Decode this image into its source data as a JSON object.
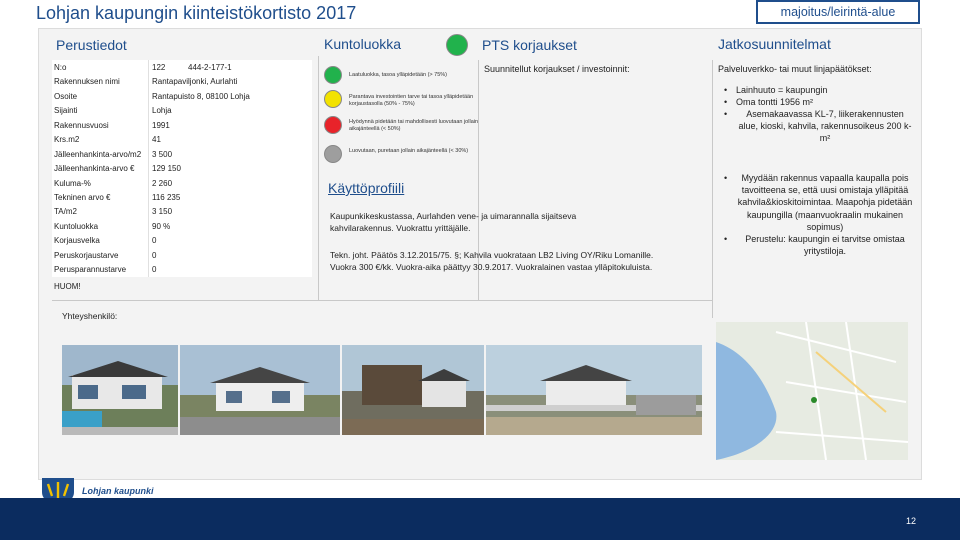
{
  "title": "Lohjan kaupungin kiinteistökortisto 2017",
  "category": "majoitus/leirintä-alue",
  "headers": {
    "basic": "Perustiedot",
    "condition": "Kuntoluokka",
    "pts": "PTS korjaukset",
    "future": "Jatkosuunnitelmat"
  },
  "condition_color": "#21b24c",
  "basic_rows": [
    {
      "k": "N:o",
      "v": "122",
      "v2": "444-2-177-1"
    },
    {
      "k": "Rakennuksen nimi",
      "v": "Rantapaviljonki, Aurlahti",
      "v2": ""
    },
    {
      "k": "Osoite",
      "v": "Rantapuisto 8, 08100 Lohja",
      "v2": ""
    },
    {
      "k": "Sijainti",
      "v": "Lohja",
      "v2": ""
    },
    {
      "k": "Rakennusvuosi",
      "v": "1991",
      "v2": ""
    },
    {
      "k": "Krs.m2",
      "v": "41",
      "v2": ""
    },
    {
      "k": "Jälleenhankinta-arvo/m2",
      "v": "3 500",
      "v2": ""
    },
    {
      "k": "Jälleenhankinta-arvo €",
      "v": "129 150",
      "v2": ""
    },
    {
      "k": "Kuluma-%",
      "v": "2 260",
      "v2": ""
    },
    {
      "k": "Tekninen arvo €",
      "v": "116 235",
      "v2": ""
    },
    {
      "k": "TA/m2",
      "v": "3 150",
      "v2": ""
    },
    {
      "k": "Kuntoluokka",
      "v": "90 %",
      "v2": ""
    },
    {
      "k": "Korjausvelka",
      "v": "0",
      "v2": ""
    },
    {
      "k": "Peruskorjaustarve",
      "v": "0",
      "v2": ""
    },
    {
      "k": "Perusparannustarve",
      "v": "0",
      "v2": ""
    }
  ],
  "huom": "HUOM!",
  "legend": [
    "Laatuluokka, tasoa ylläpidetään (> 75%)",
    "Parantava investointien tarve tai tasoa ylläpidetään korjaustasolla (50% - 75%)",
    "Hyödynnä pidetään tai mahdollisesti luovutaan jollain aikajänteellä (< 50%)",
    "Luovutaan, puretaan jollain aikajänteellä (< 30%)"
  ],
  "profile": {
    "title": "Käyttöprofiili",
    "p1": "Kaupunkikeskustassa, Aurlahden vene- ja uimarannalla sijaitseva kahvilarakennus. Vuokrattu yrittäjälle.",
    "p2": "Tekn. joht. Päätös 3.12.2015/75. §; Kahvila vuokrataan LB2 Living OY/Riku Lomanille. Vuokra 300 €/kk. Vuokra-aika päättyy 30.9.2017. Vuokralainen vastaa ylläpitokuluista."
  },
  "pts_text": "Suunnitellut korjaukset / investoinnit:",
  "future_text": "Palveluverkko- tai muut linjapäätökset:",
  "bullets1": [
    "Lainhuuto = kaupungin",
    "Oma tontti 1956 m²",
    "Asemakaavassa KL-7, liikerakennusten alue, kioski, kahvila, rakennusoikeus 200 k-m²"
  ],
  "bullets2": [
    "Myydään rakennus vapaalla kaupalla pois tavoitteena se, että uusi omistaja ylläpitää kahvila&kioskitoimintaa. Maapohja pidetään kaupungilla (maanvuokraalin mukainen sopimus)",
    "Perustelu: kaupungin ei tarvitse omistaa yritystiloja."
  ],
  "contact": "Yhteyshenkilö:",
  "logo_text": "Lohjan kaupunki",
  "page_number": "12"
}
